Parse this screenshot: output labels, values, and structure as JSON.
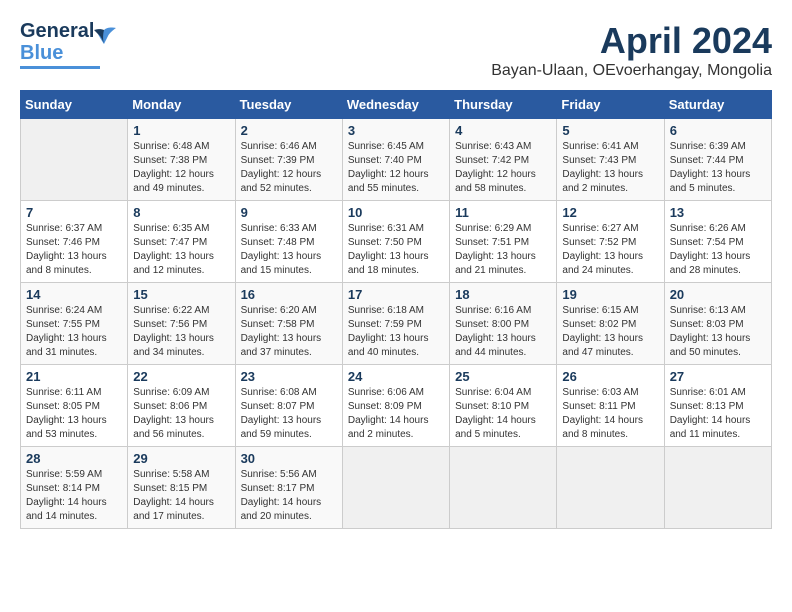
{
  "logo": {
    "line1": "General",
    "line2": "Blue"
  },
  "title": "April 2024",
  "location": "Bayan-Ulaan, OEvoerhangay, Mongolia",
  "header": {
    "days": [
      "Sunday",
      "Monday",
      "Tuesday",
      "Wednesday",
      "Thursday",
      "Friday",
      "Saturday"
    ]
  },
  "weeks": [
    [
      {
        "day": "",
        "sunrise": "",
        "sunset": "",
        "daylight": ""
      },
      {
        "day": "1",
        "sunrise": "Sunrise: 6:48 AM",
        "sunset": "Sunset: 7:38 PM",
        "daylight": "Daylight: 12 hours and 49 minutes."
      },
      {
        "day": "2",
        "sunrise": "Sunrise: 6:46 AM",
        "sunset": "Sunset: 7:39 PM",
        "daylight": "Daylight: 12 hours and 52 minutes."
      },
      {
        "day": "3",
        "sunrise": "Sunrise: 6:45 AM",
        "sunset": "Sunset: 7:40 PM",
        "daylight": "Daylight: 12 hours and 55 minutes."
      },
      {
        "day": "4",
        "sunrise": "Sunrise: 6:43 AM",
        "sunset": "Sunset: 7:42 PM",
        "daylight": "Daylight: 12 hours and 58 minutes."
      },
      {
        "day": "5",
        "sunrise": "Sunrise: 6:41 AM",
        "sunset": "Sunset: 7:43 PM",
        "daylight": "Daylight: 13 hours and 2 minutes."
      },
      {
        "day": "6",
        "sunrise": "Sunrise: 6:39 AM",
        "sunset": "Sunset: 7:44 PM",
        "daylight": "Daylight: 13 hours and 5 minutes."
      }
    ],
    [
      {
        "day": "7",
        "sunrise": "Sunrise: 6:37 AM",
        "sunset": "Sunset: 7:46 PM",
        "daylight": "Daylight: 13 hours and 8 minutes."
      },
      {
        "day": "8",
        "sunrise": "Sunrise: 6:35 AM",
        "sunset": "Sunset: 7:47 PM",
        "daylight": "Daylight: 13 hours and 12 minutes."
      },
      {
        "day": "9",
        "sunrise": "Sunrise: 6:33 AM",
        "sunset": "Sunset: 7:48 PM",
        "daylight": "Daylight: 13 hours and 15 minutes."
      },
      {
        "day": "10",
        "sunrise": "Sunrise: 6:31 AM",
        "sunset": "Sunset: 7:50 PM",
        "daylight": "Daylight: 13 hours and 18 minutes."
      },
      {
        "day": "11",
        "sunrise": "Sunrise: 6:29 AM",
        "sunset": "Sunset: 7:51 PM",
        "daylight": "Daylight: 13 hours and 21 minutes."
      },
      {
        "day": "12",
        "sunrise": "Sunrise: 6:27 AM",
        "sunset": "Sunset: 7:52 PM",
        "daylight": "Daylight: 13 hours and 24 minutes."
      },
      {
        "day": "13",
        "sunrise": "Sunrise: 6:26 AM",
        "sunset": "Sunset: 7:54 PM",
        "daylight": "Daylight: 13 hours and 28 minutes."
      }
    ],
    [
      {
        "day": "14",
        "sunrise": "Sunrise: 6:24 AM",
        "sunset": "Sunset: 7:55 PM",
        "daylight": "Daylight: 13 hours and 31 minutes."
      },
      {
        "day": "15",
        "sunrise": "Sunrise: 6:22 AM",
        "sunset": "Sunset: 7:56 PM",
        "daylight": "Daylight: 13 hours and 34 minutes."
      },
      {
        "day": "16",
        "sunrise": "Sunrise: 6:20 AM",
        "sunset": "Sunset: 7:58 PM",
        "daylight": "Daylight: 13 hours and 37 minutes."
      },
      {
        "day": "17",
        "sunrise": "Sunrise: 6:18 AM",
        "sunset": "Sunset: 7:59 PM",
        "daylight": "Daylight: 13 hours and 40 minutes."
      },
      {
        "day": "18",
        "sunrise": "Sunrise: 6:16 AM",
        "sunset": "Sunset: 8:00 PM",
        "daylight": "Daylight: 13 hours and 44 minutes."
      },
      {
        "day": "19",
        "sunrise": "Sunrise: 6:15 AM",
        "sunset": "Sunset: 8:02 PM",
        "daylight": "Daylight: 13 hours and 47 minutes."
      },
      {
        "day": "20",
        "sunrise": "Sunrise: 6:13 AM",
        "sunset": "Sunset: 8:03 PM",
        "daylight": "Daylight: 13 hours and 50 minutes."
      }
    ],
    [
      {
        "day": "21",
        "sunrise": "Sunrise: 6:11 AM",
        "sunset": "Sunset: 8:05 PM",
        "daylight": "Daylight: 13 hours and 53 minutes."
      },
      {
        "day": "22",
        "sunrise": "Sunrise: 6:09 AM",
        "sunset": "Sunset: 8:06 PM",
        "daylight": "Daylight: 13 hours and 56 minutes."
      },
      {
        "day": "23",
        "sunrise": "Sunrise: 6:08 AM",
        "sunset": "Sunset: 8:07 PM",
        "daylight": "Daylight: 13 hours and 59 minutes."
      },
      {
        "day": "24",
        "sunrise": "Sunrise: 6:06 AM",
        "sunset": "Sunset: 8:09 PM",
        "daylight": "Daylight: 14 hours and 2 minutes."
      },
      {
        "day": "25",
        "sunrise": "Sunrise: 6:04 AM",
        "sunset": "Sunset: 8:10 PM",
        "daylight": "Daylight: 14 hours and 5 minutes."
      },
      {
        "day": "26",
        "sunrise": "Sunrise: 6:03 AM",
        "sunset": "Sunset: 8:11 PM",
        "daylight": "Daylight: 14 hours and 8 minutes."
      },
      {
        "day": "27",
        "sunrise": "Sunrise: 6:01 AM",
        "sunset": "Sunset: 8:13 PM",
        "daylight": "Daylight: 14 hours and 11 minutes."
      }
    ],
    [
      {
        "day": "28",
        "sunrise": "Sunrise: 5:59 AM",
        "sunset": "Sunset: 8:14 PM",
        "daylight": "Daylight: 14 hours and 14 minutes."
      },
      {
        "day": "29",
        "sunrise": "Sunrise: 5:58 AM",
        "sunset": "Sunset: 8:15 PM",
        "daylight": "Daylight: 14 hours and 17 minutes."
      },
      {
        "day": "30",
        "sunrise": "Sunrise: 5:56 AM",
        "sunset": "Sunset: 8:17 PM",
        "daylight": "Daylight: 14 hours and 20 minutes."
      },
      {
        "day": "",
        "sunrise": "",
        "sunset": "",
        "daylight": ""
      },
      {
        "day": "",
        "sunrise": "",
        "sunset": "",
        "daylight": ""
      },
      {
        "day": "",
        "sunrise": "",
        "sunset": "",
        "daylight": ""
      },
      {
        "day": "",
        "sunrise": "",
        "sunset": "",
        "daylight": ""
      }
    ]
  ]
}
